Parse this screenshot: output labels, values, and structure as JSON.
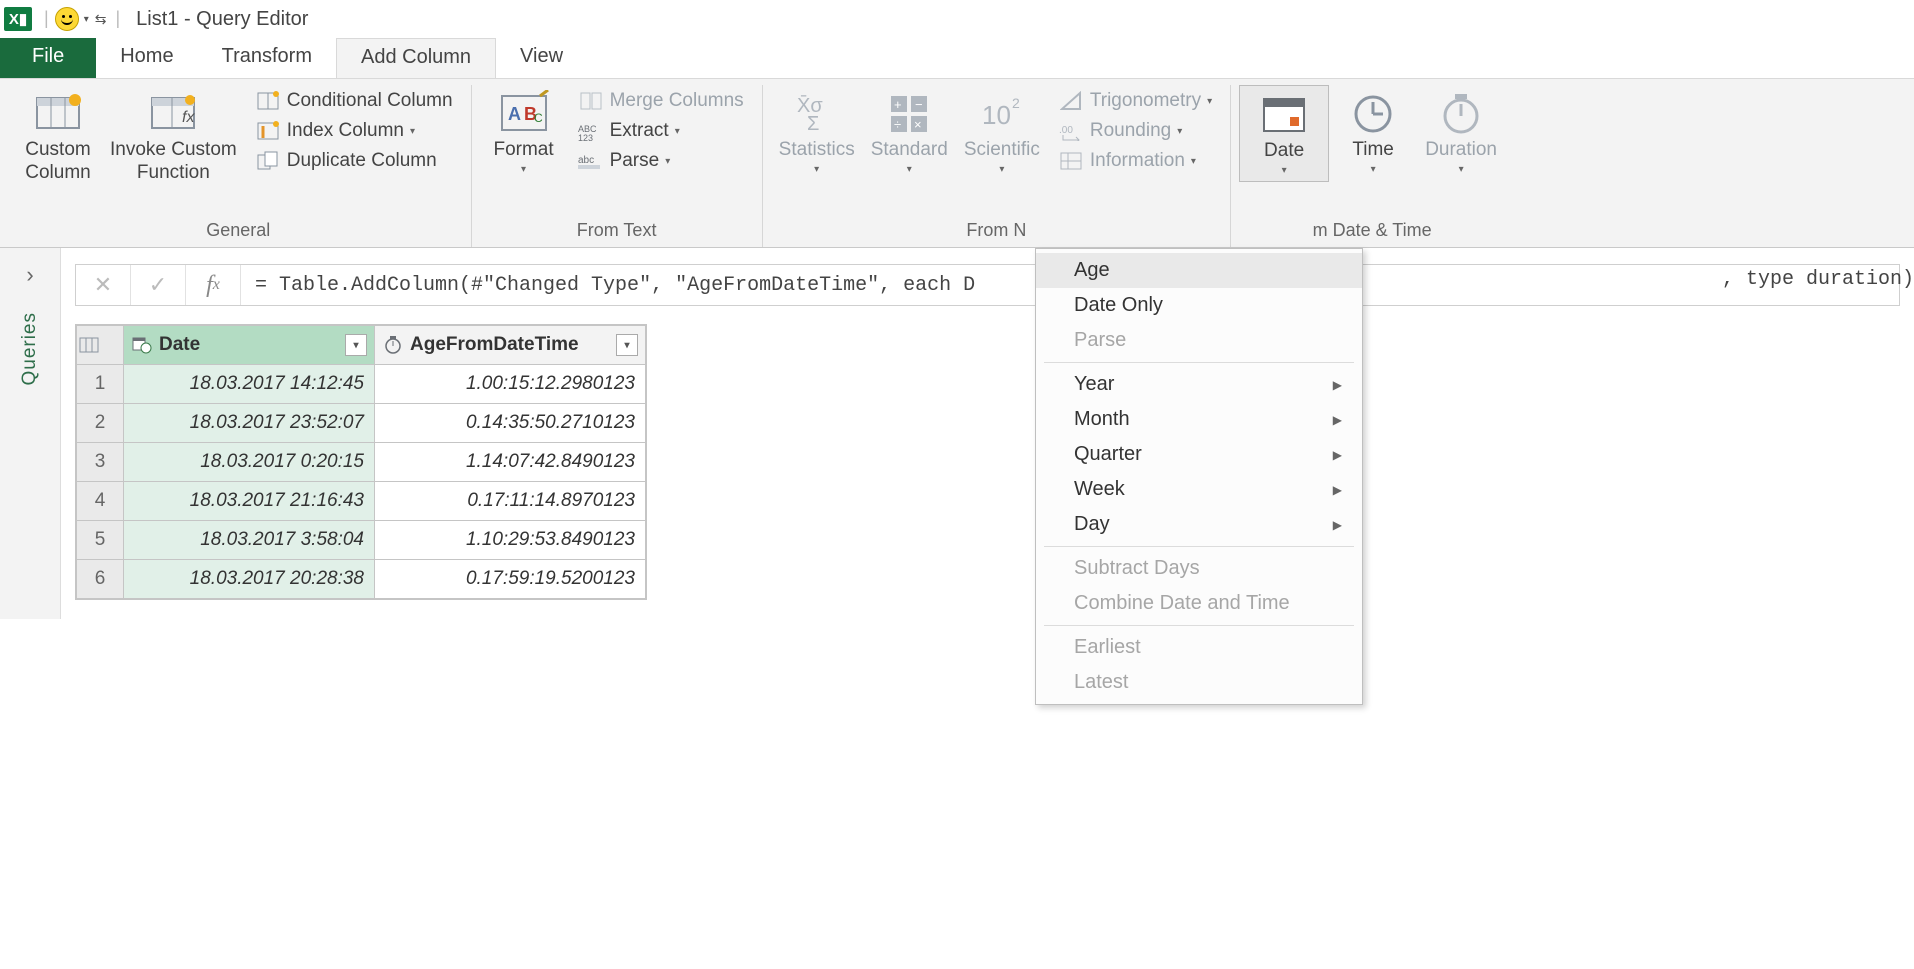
{
  "title": "List1 - Query Editor",
  "tabs": {
    "file": "File",
    "home": "Home",
    "transform": "Transform",
    "add_column": "Add Column",
    "view": "View"
  },
  "ribbon": {
    "general": {
      "label": "General",
      "custom_column": "Custom\nColumn",
      "invoke_custom_function": "Invoke Custom\nFunction",
      "conditional_column": "Conditional Column",
      "index_column": "Index Column",
      "duplicate_column": "Duplicate Column"
    },
    "from_text": {
      "label": "From Text",
      "format": "Format",
      "merge_columns": "Merge Columns",
      "extract": "Extract",
      "parse": "Parse"
    },
    "from_number": {
      "label_visible": "From N",
      "statistics": "Statistics",
      "standard": "Standard",
      "scientific": "Scientific",
      "trigonometry": "Trigonometry",
      "rounding": "Rounding",
      "information": "Information"
    },
    "from_datetime": {
      "label_visible": "m Date & Time",
      "date": "Date",
      "time": "Time",
      "duration": "Duration"
    }
  },
  "date_menu": {
    "items": [
      {
        "label": "Age",
        "enabled": true,
        "submenu": false,
        "hover": true
      },
      {
        "label": "Date Only",
        "enabled": true,
        "submenu": false
      },
      {
        "label": "Parse",
        "enabled": false,
        "submenu": false
      },
      {
        "sep": true
      },
      {
        "label": "Year",
        "enabled": true,
        "submenu": true
      },
      {
        "label": "Month",
        "enabled": true,
        "submenu": true
      },
      {
        "label": "Quarter",
        "enabled": true,
        "submenu": true
      },
      {
        "label": "Week",
        "enabled": true,
        "submenu": true
      },
      {
        "label": "Day",
        "enabled": true,
        "submenu": true
      },
      {
        "sep": true
      },
      {
        "label": "Subtract Days",
        "enabled": false,
        "submenu": false
      },
      {
        "label": "Combine Date and Time",
        "enabled": false,
        "submenu": false
      },
      {
        "sep": true
      },
      {
        "label": "Earliest",
        "enabled": false,
        "submenu": false
      },
      {
        "label": "Latest",
        "enabled": false,
        "submenu": false
      }
    ]
  },
  "sidebar": {
    "queries_label": "Queries"
  },
  "formula_bar": {
    "text": "= Table.AddColumn(#\"Changed Type\", \"AgeFromDateTime\", each D",
    "tail": ", type duration)"
  },
  "grid": {
    "columns": [
      {
        "header": "Date",
        "type": "datetime"
      },
      {
        "header": "AgeFromDateTime",
        "type": "duration"
      }
    ],
    "rows": [
      {
        "n": "1",
        "date": "18.03.2017 14:12:45",
        "age": "1.00:15:12.2980123"
      },
      {
        "n": "2",
        "date": "18.03.2017 23:52:07",
        "age": "0.14:35:50.2710123"
      },
      {
        "n": "3",
        "date": "18.03.2017 0:20:15",
        "age": "1.14:07:42.8490123"
      },
      {
        "n": "4",
        "date": "18.03.2017 21:16:43",
        "age": "0.17:11:14.8970123"
      },
      {
        "n": "5",
        "date": "18.03.2017 3:58:04",
        "age": "1.10:29:53.8490123"
      },
      {
        "n": "6",
        "date": "18.03.2017 20:28:38",
        "age": "0.17:59:19.5200123"
      }
    ]
  }
}
